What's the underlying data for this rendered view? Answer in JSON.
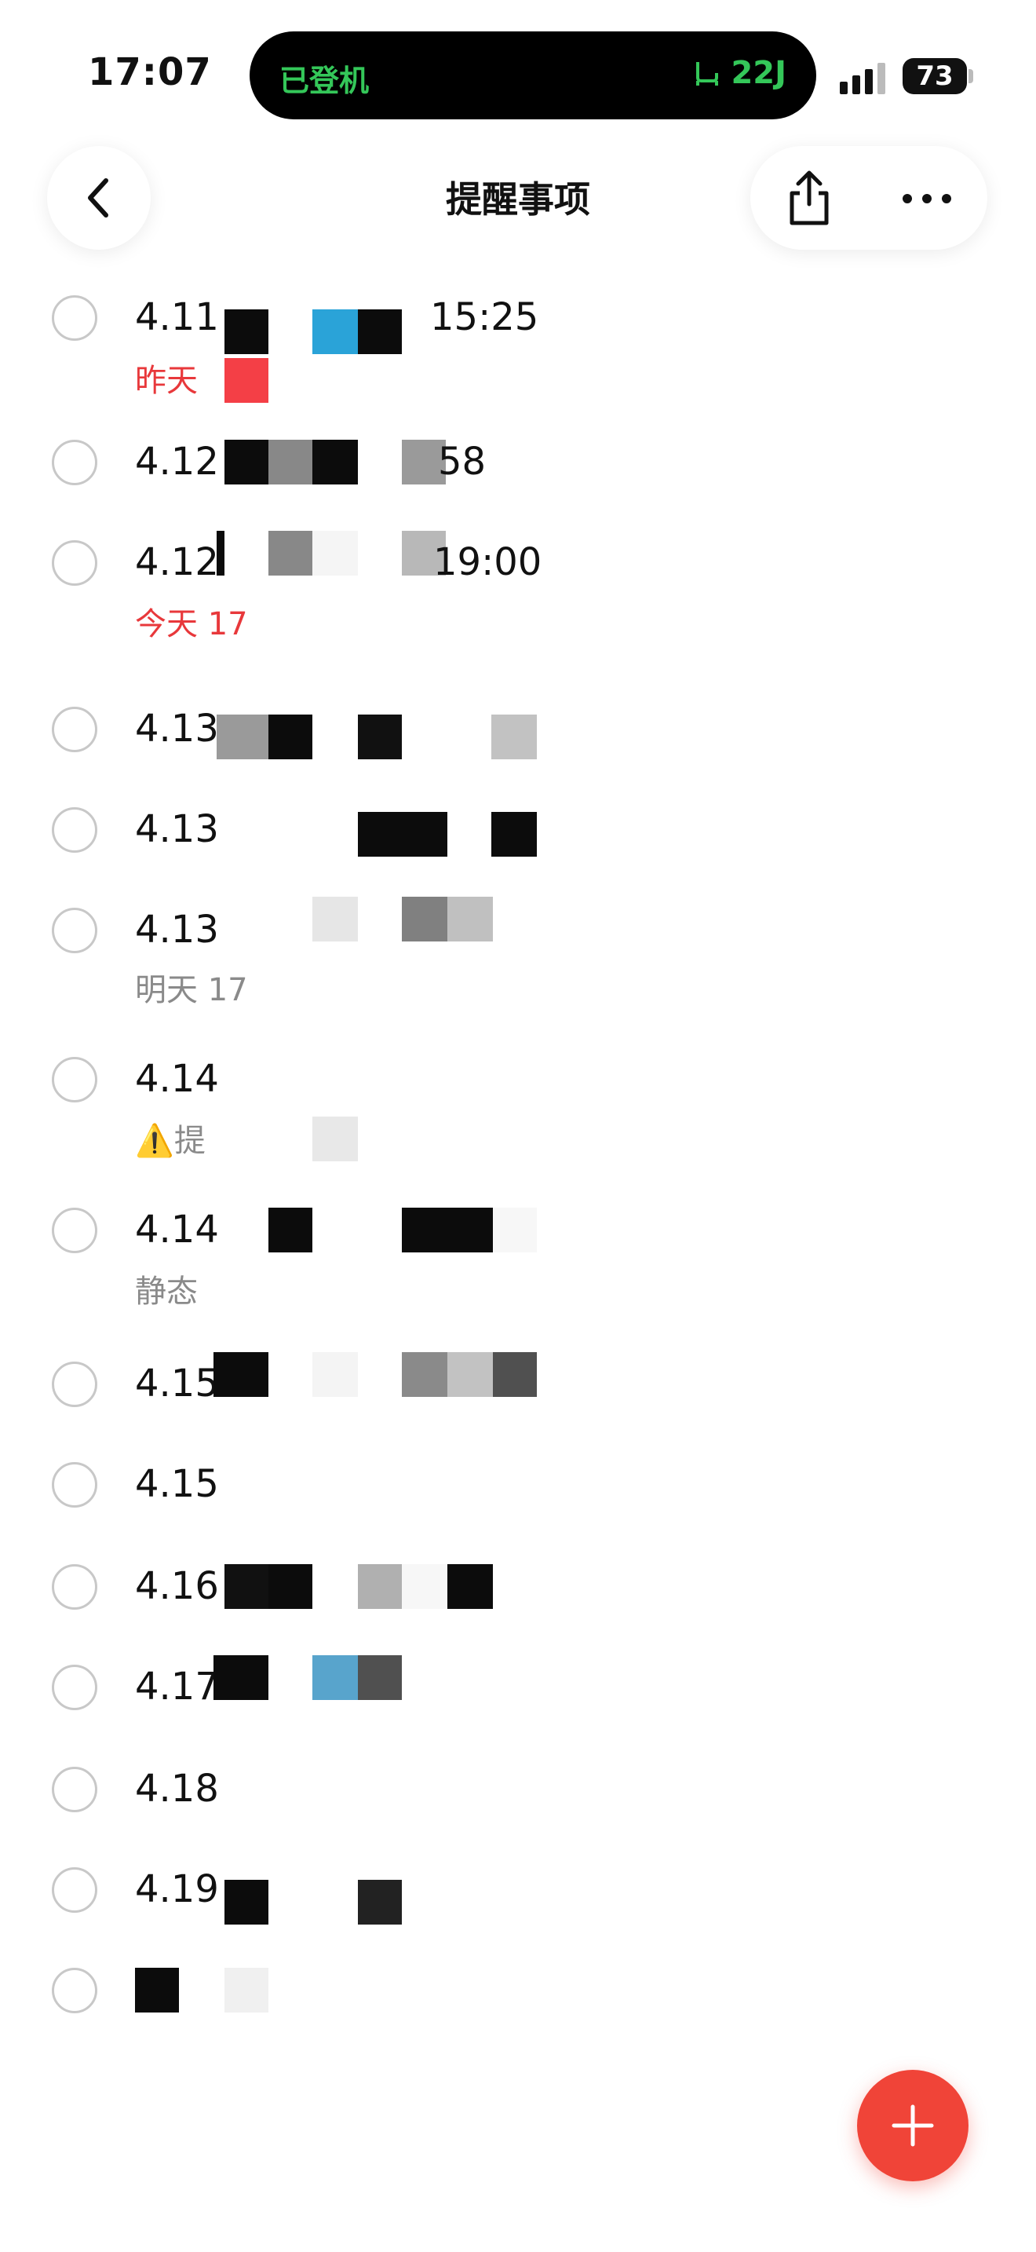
{
  "status_bar": {
    "time": "17:07",
    "island_left": "已登机",
    "island_right": "22J",
    "battery": "73"
  },
  "header": {
    "title": "提醒事项"
  },
  "reminders": [
    {
      "title": "4.11",
      "time": "15:25",
      "subtitle": "昨天",
      "subtitle_color": "red"
    },
    {
      "title": "4.12",
      "time": "58",
      "subtitle": ""
    },
    {
      "title": "4.12",
      "time": "19:00",
      "subtitle": "今天 17",
      "subtitle_color": "red"
    },
    {
      "title": "4.13",
      "time": "",
      "subtitle": ""
    },
    {
      "title": "4.13",
      "time": "",
      "subtitle": ""
    },
    {
      "title": "4.13",
      "time": "",
      "subtitle": "明天 17",
      "subtitle_color": "gray"
    },
    {
      "title": "4.14",
      "time": "",
      "subtitle": "提",
      "subtitle_color": "gray",
      "warning": "⚠️"
    },
    {
      "title": "4.14",
      "time": "",
      "subtitle": "静态",
      "subtitle_color": "gray"
    },
    {
      "title": "4.15",
      "time": "",
      "subtitle": ""
    },
    {
      "title": "4.15",
      "time": "",
      "subtitle": ""
    },
    {
      "title": "4.16",
      "time": "",
      "subtitle": ""
    },
    {
      "title": "4.17",
      "time": "",
      "subtitle": ""
    },
    {
      "title": "4.18",
      "time": "",
      "subtitle": ""
    },
    {
      "title": "4.19",
      "time": "",
      "subtitle": ""
    },
    {
      "title": "",
      "time": "",
      "subtitle": ""
    }
  ],
  "fab": {
    "icon": "plus-icon"
  },
  "colors": {
    "accent_red": "#f04438",
    "subtitle_red": "#e8383b",
    "island_green": "#34c759"
  }
}
